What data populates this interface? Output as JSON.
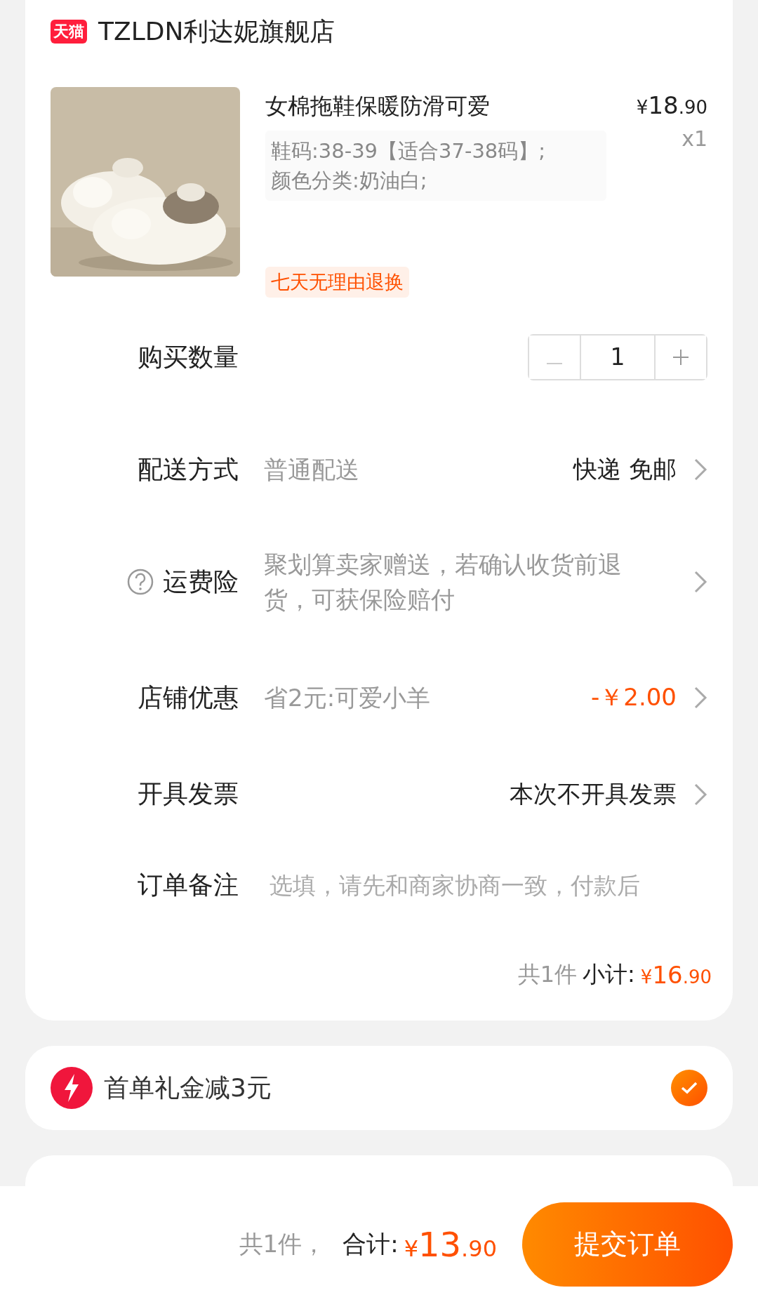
{
  "store": {
    "name": "TZLDN利达妮旗舰店",
    "badge": "天猫"
  },
  "product": {
    "title": "女棉拖鞋保暖防滑可爱",
    "specs": [
      "鞋码:38-39【适合37-38码】;",
      "颜色分类:奶油白;"
    ],
    "price": "¥18.90",
    "quantity": "x1",
    "tag": "七天无理由退换"
  },
  "rows": [
    {
      "kind": "stepper",
      "label": "购买数量",
      "has_help": false,
      "value": "1",
      "minus_disabled": true
    },
    {
      "kind": "select",
      "label": "配送方式",
      "has_help": false,
      "detail": "普通配送",
      "value": "快递 免邮"
    },
    {
      "kind": "select",
      "label": "运费险",
      "has_help": true,
      "detail": "聚划算卖家赠送，若确认收货前退货，可获保险赔付"
    },
    {
      "kind": "discount",
      "label": "店铺优惠",
      "has_help": false,
      "detail": "省2元:可爱小羊",
      "value": "-￥2.00"
    },
    {
      "kind": "select",
      "label": "开具发票",
      "has_help": false,
      "value": "本次不开具发票"
    },
    {
      "kind": "note",
      "label": "订单备注",
      "has_help": false,
      "placeholder": "选填，请先和商家协商一致，付款后"
    }
  ],
  "subtotal": {
    "count": "共1件",
    "label": "小计:",
    "amount": "¥16.90"
  },
  "coupon": {
    "text": "首单礼金减3元",
    "checked": true
  },
  "footer": {
    "count": "共1件，",
    "label": "合计:",
    "amount": "¥13.90",
    "button": "提交订单"
  }
}
